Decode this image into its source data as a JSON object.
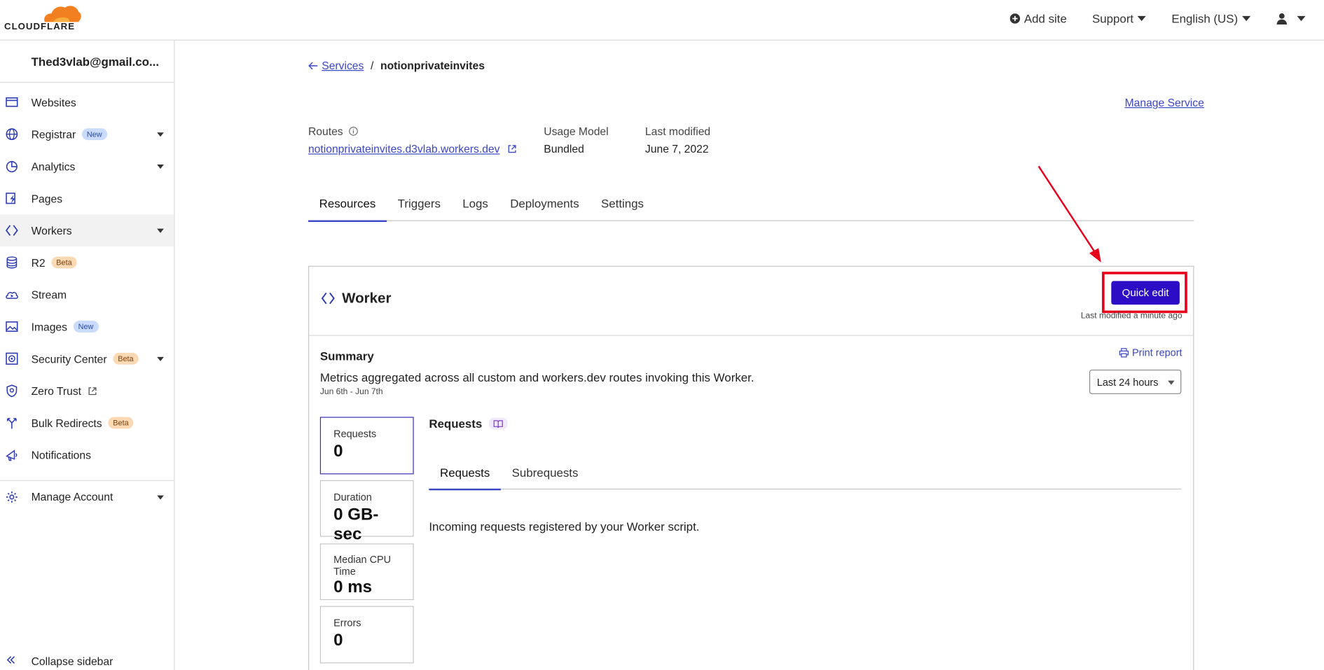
{
  "brand": {
    "logo_text": "CLOUDFLARE",
    "cloud_color": "#f38020"
  },
  "topbar": {
    "add_site": "Add site",
    "support": "Support",
    "language": "English (US)"
  },
  "sidebar": {
    "account": "Thed3vlab@gmail.co...",
    "items": [
      {
        "label": "Websites"
      },
      {
        "label": "Registrar",
        "badge": "New"
      },
      {
        "label": "Analytics"
      },
      {
        "label": "Pages"
      },
      {
        "label": "Workers"
      },
      {
        "label": "R2",
        "badge": "Beta"
      },
      {
        "label": "Stream"
      },
      {
        "label": "Images",
        "badge": "New"
      },
      {
        "label": "Security Center",
        "badge": "Beta"
      },
      {
        "label": "Zero Trust"
      },
      {
        "label": "Bulk Redirects",
        "badge": "Beta"
      },
      {
        "label": "Notifications"
      },
      {
        "label": "Manage Account"
      }
    ],
    "collapse": "Collapse sidebar"
  },
  "breadcrumb": {
    "back": "Services",
    "separator": "/",
    "current": "notionprivateinvites"
  },
  "manage_service": "Manage Service",
  "meta": {
    "routes_label": "Routes",
    "routes_value": "notionprivateinvites.d3vlab.workers.dev",
    "usage_label": "Usage Model",
    "usage_value": "Bundled",
    "modified_label": "Last modified",
    "modified_value": "June 7, 2022"
  },
  "tabs": [
    "Resources",
    "Triggers",
    "Logs",
    "Deployments",
    "Settings"
  ],
  "worker": {
    "title": "Worker",
    "quick_edit": "Quick edit",
    "last_modified": "Last modified a minute ago"
  },
  "summary": {
    "title": "Summary",
    "description": "Metrics aggregated across all custom and workers.dev routes invoking this Worker.",
    "date_range": "Jun 6th - Jun 7th",
    "print": "Print report",
    "period": "Last 24 hours"
  },
  "metrics": [
    {
      "label": "Requests",
      "value": "0"
    },
    {
      "label": "Duration",
      "value": "0 GB-sec"
    },
    {
      "label": "Median CPU Time",
      "value": "0 ms"
    },
    {
      "label": "Errors",
      "value": "0"
    }
  ],
  "requests_panel": {
    "title": "Requests",
    "subtabs": [
      "Requests",
      "Subrequests"
    ],
    "text": "Incoming requests registered by your Worker script."
  },
  "colors": {
    "accent": "#3a45c7",
    "button": "#2c0cc5",
    "highlight": "#e7001a"
  }
}
